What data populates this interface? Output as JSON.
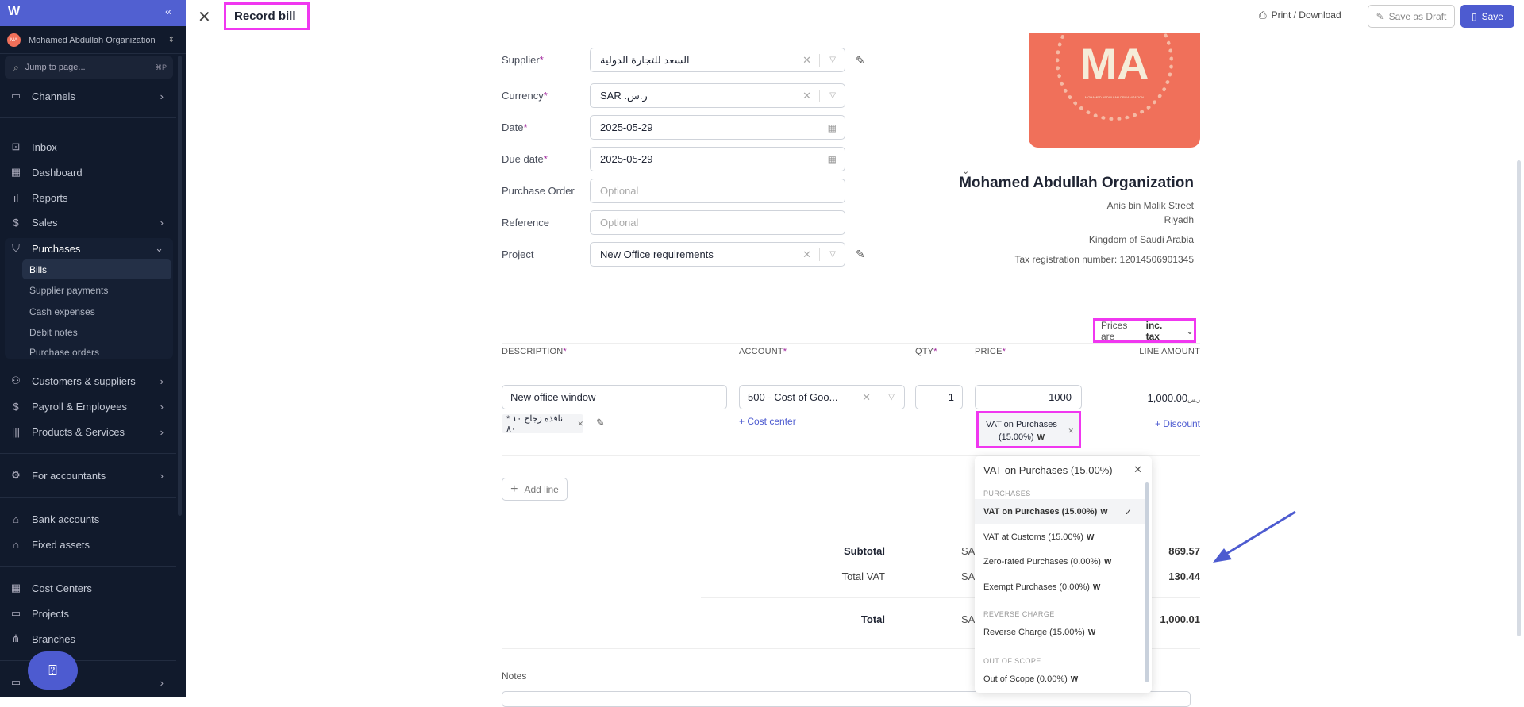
{
  "sidebar": {
    "org_initials": "MA",
    "org_name": "Mohamed Abdullah Organization",
    "search_placeholder": "Jump to page...",
    "search_shortcut": "⌘P",
    "items": {
      "channels": "Channels",
      "inbox": "Inbox",
      "dashboard": "Dashboard",
      "reports": "Reports",
      "sales": "Sales",
      "purchases": "Purchases",
      "customers": "Customers & suppliers",
      "payroll": "Payroll & Employees",
      "products": "Products & Services",
      "accountants": "For accountants",
      "bank": "Bank accounts",
      "fixed": "Fixed assets",
      "cost_centers": "Cost Centers",
      "projects": "Projects",
      "branches": "Branches"
    },
    "purchases_sub": {
      "bills": "Bills",
      "supplier_payments": "Supplier payments",
      "cash_expenses": "Cash expenses",
      "debit_notes": "Debit notes",
      "purchase_orders": "Purchase orders"
    }
  },
  "header": {
    "title": "Record bill",
    "print": "Print / Download",
    "draft": "Save as Draft",
    "save": "Save"
  },
  "form": {
    "supplier_label": "Supplier",
    "supplier": "السعد للتجارة الدولية",
    "currency_label": "Currency",
    "currency": "SAR .ر.س",
    "date_label": "Date",
    "date": "2025-05-29",
    "due_label": "Due date",
    "due": "2025-05-29",
    "po_label": "Purchase Order",
    "po_placeholder": "Optional",
    "ref_label": "Reference",
    "ref_placeholder": "Optional",
    "project_label": "Project",
    "project": "New Office requirements",
    "req": "*"
  },
  "org": {
    "logo_text": "MA",
    "logo_sub": "MOHAMED ABDULLAH ORGANIZATION",
    "name": "Mohamed Abdullah Organization",
    "street": "Anis bin Malik Street",
    "city": "Riyadh",
    "country": "Kingdom of Saudi Arabia",
    "tax": "Tax registration number: 12014506901345"
  },
  "prices": {
    "prefix": "Prices are",
    "value": "inc. tax"
  },
  "table": {
    "headers": {
      "description": "DESCRIPTION",
      "account": "ACCOUNT",
      "qty": "QTY",
      "price": "PRICE",
      "line_amount": "LINE AMOUNT"
    },
    "line": {
      "description": "New office window",
      "tag": "نافذة زجاج ١٠ * ٨٠",
      "account": "500 - Cost of Goo...",
      "qty": "1",
      "price": "1000",
      "amount": "1,000.00",
      "amount_currency": "ر.س",
      "cost_center": "+ Cost center",
      "vat": "VAT on Purchases (15.00%)",
      "vat_line1": "VAT on Purchases",
      "vat_line2": "(15.00%)",
      "discount": "+ Discount"
    },
    "add_line": "Add line"
  },
  "totals": {
    "subtotal_label": "Subtotal",
    "subtotal": "869.57",
    "vat_label": "Total VAT",
    "vat": "130.44",
    "total_label": "Total",
    "total": "1,000.01",
    "currency": "SA"
  },
  "notes_label": "Notes",
  "vat_menu": {
    "title": "VAT on Purchases (15.00%)",
    "groups": [
      {
        "label": "PURCHASES",
        "items": [
          "VAT on Purchases (15.00%)",
          "VAT at Customs (15.00%)",
          "Zero-rated Purchases (0.00%)",
          "Exempt Purchases (0.00%)"
        ]
      },
      {
        "label": "REVERSE CHARGE",
        "items": [
          "Reverse Charge (15.00%)"
        ]
      },
      {
        "label": "OUT OF SCOPE",
        "items": [
          "Out of Scope (0.00%)"
        ]
      }
    ],
    "selected": "VAT on Purchases (15.00%)"
  },
  "colors": {
    "brand": "#5160d1",
    "sidebar": "#111a2c",
    "highlight": "#f037f0",
    "logo": "#f0705a"
  }
}
